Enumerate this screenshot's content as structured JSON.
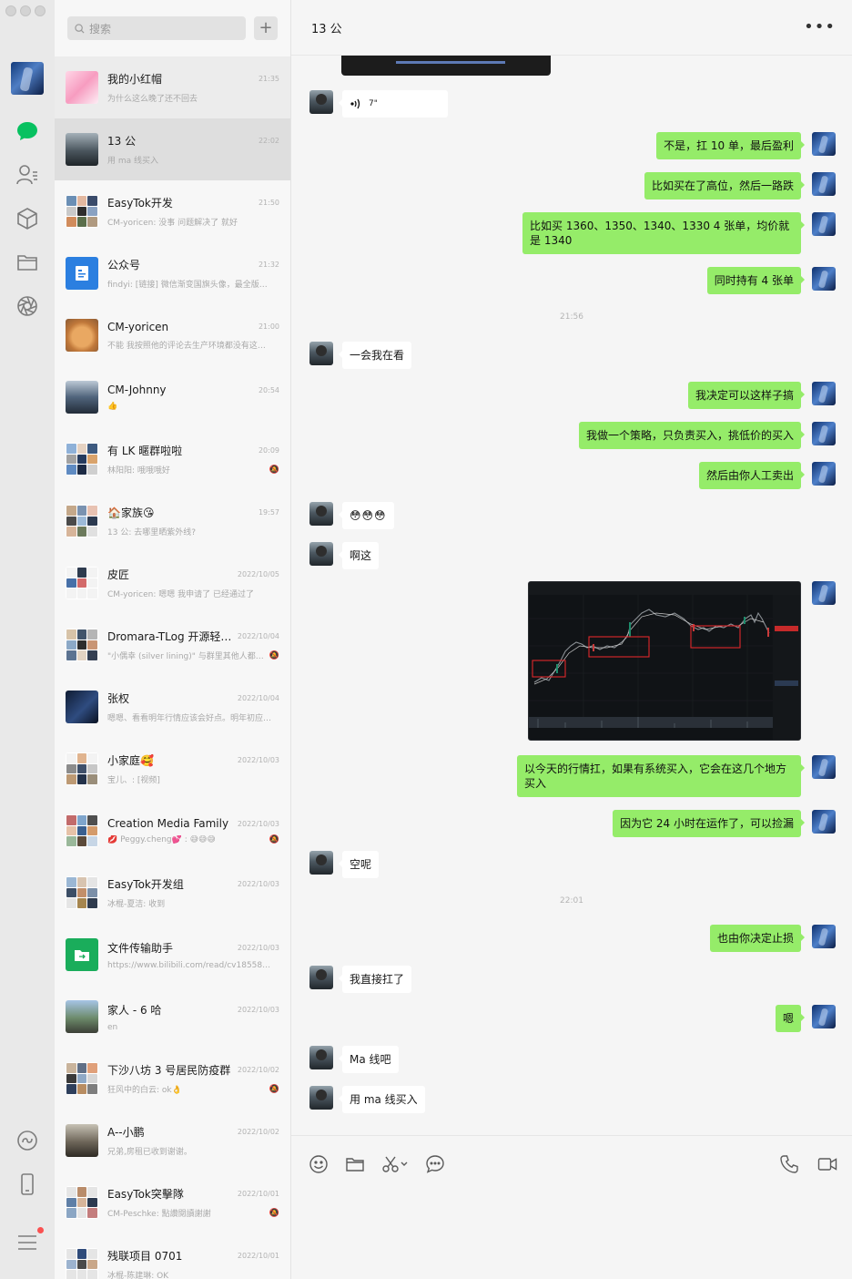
{
  "search": {
    "placeholder": "搜索"
  },
  "chats": [
    {
      "name": "我的小红帽",
      "time": "21:35",
      "preview": "为什么这么晚了还不回去",
      "muted": false
    },
    {
      "name": "13 公",
      "time": "22:02",
      "preview": "用 ma 线买入",
      "muted": false
    },
    {
      "name": "EasyTok开发",
      "time": "21:50",
      "preview": "CM-yoricen: 没事  问题解决了 就好",
      "muted": false
    },
    {
      "name": "公众号",
      "time": "21:32",
      "preview": "findyi: [链接] 微信渐变国旗头像，最全版本…",
      "muted": false
    },
    {
      "name": "CM-yoricen",
      "time": "21:00",
      "preview": "不能  我按照他的评论去生产环境都没有这…",
      "muted": false
    },
    {
      "name": "CM-Johnny",
      "time": "20:54",
      "preview": "👍",
      "muted": false
    },
    {
      "name": "有 LK 暱群啦啦",
      "time": "20:09",
      "preview": "林阳阳: 哦哦哦好",
      "muted": true
    },
    {
      "name": "🏠家族😘",
      "time": "19:57",
      "preview": "13 公: 去哪里晒紫外线?",
      "muted": false
    },
    {
      "name": "皮匠",
      "time": "2022/10/05",
      "preview": "CM-yoricen: 嗯嗯 我申请了 已经通过了",
      "muted": false
    },
    {
      "name": "Dromara-TLog 开源轻量…",
      "time": "2022/10/04",
      "preview": "\"小偶幸 (silver lining)\" 与群里其他人都不…",
      "muted": true
    },
    {
      "name": "张权",
      "time": "2022/10/04",
      "preview": "嗯嗯、看看明年行情应该会好点。明年初应…",
      "muted": false
    },
    {
      "name": "小家庭🥰",
      "time": "2022/10/03",
      "preview": "宝儿、: [视频]",
      "muted": false
    },
    {
      "name": "Creation Media Family",
      "time": "2022/10/03",
      "preview": "💋 Peggy.cheng💕 : 😅😅😅",
      "muted": true
    },
    {
      "name": "EasyTok开发组",
      "time": "2022/10/03",
      "preview": "冰棍-夏洁: 收到",
      "muted": false
    },
    {
      "name": "文件传输助手",
      "time": "2022/10/03",
      "preview": "https://www.bilibili.com/read/cv18558541",
      "muted": false
    },
    {
      "name": "家人 - 6 哈",
      "time": "2022/10/03",
      "preview": "en",
      "muted": false
    },
    {
      "name": "下沙八坊 3 号居民防疫群",
      "time": "2022/10/02",
      "preview": "狂风中的白云: ok👌",
      "muted": true
    },
    {
      "name": "A--小鹏",
      "time": "2022/10/02",
      "preview": "兄弟,房租已收到谢谢。",
      "muted": false
    },
    {
      "name": "EasyTok突擊隊",
      "time": "2022/10/01",
      "preview": "CM-Peschke: 點讚閱讀謝謝",
      "muted": true
    },
    {
      "name": "残联项目 0701",
      "time": "2022/10/01",
      "preview": "冰棍-陈建琳: OK",
      "muted": false
    }
  ],
  "conversation": {
    "title": "13 公",
    "more_label": "•••",
    "voice_duration": "7\"",
    "messages": [
      {
        "side": "right",
        "text": "不是，扛 10 单，最后盈利"
      },
      {
        "side": "right",
        "text": "比如买在了高位，然后一路跌"
      },
      {
        "side": "right",
        "text": "比如买 1360、1350、1340、1330 4 张单，均价就是 1340"
      },
      {
        "side": "right",
        "text": "同时持有 4 张单"
      },
      {
        "side": "left",
        "text": "一会我在看"
      },
      {
        "side": "right",
        "text": "我决定可以这样子搞"
      },
      {
        "side": "right",
        "text": "我做一个策略，只负责买入，挑低价的买入"
      },
      {
        "side": "right",
        "text": "然后由你人工卖出"
      },
      {
        "side": "left",
        "text": "😳😳😳"
      },
      {
        "side": "left",
        "text": "啊这"
      },
      {
        "side": "right",
        "text": "以今天的行情扛，如果有系统买入，它会在这几个地方买入"
      },
      {
        "side": "right",
        "text": "因为它 24 小时在运作了，可以捡漏"
      },
      {
        "side": "left",
        "text": "空呢"
      },
      {
        "side": "right",
        "text": "也由你决定止损"
      },
      {
        "side": "left",
        "text": "我直接扛了"
      },
      {
        "side": "right",
        "text": "嗯"
      },
      {
        "side": "left",
        "text": "Ma 线吧"
      },
      {
        "side": "left",
        "text": "用 ma 线买入"
      }
    ],
    "timestamps": [
      "21:56",
      "22:01"
    ]
  },
  "colors": {
    "bubble_mine": "#95ec69",
    "bubble_other": "#ffffff",
    "accent_green": "#07c160"
  },
  "icons": {
    "rail": [
      "chat-icon",
      "contacts-icon",
      "favorites-icon",
      "files-icon",
      "moments-icon",
      "mini-programs-icon",
      "phone-icon",
      "menu-icon"
    ],
    "composer": [
      "emoji-icon",
      "folder-icon",
      "scissors-icon",
      "chat-bubble-icon",
      "phone-call-icon",
      "video-call-icon"
    ]
  }
}
